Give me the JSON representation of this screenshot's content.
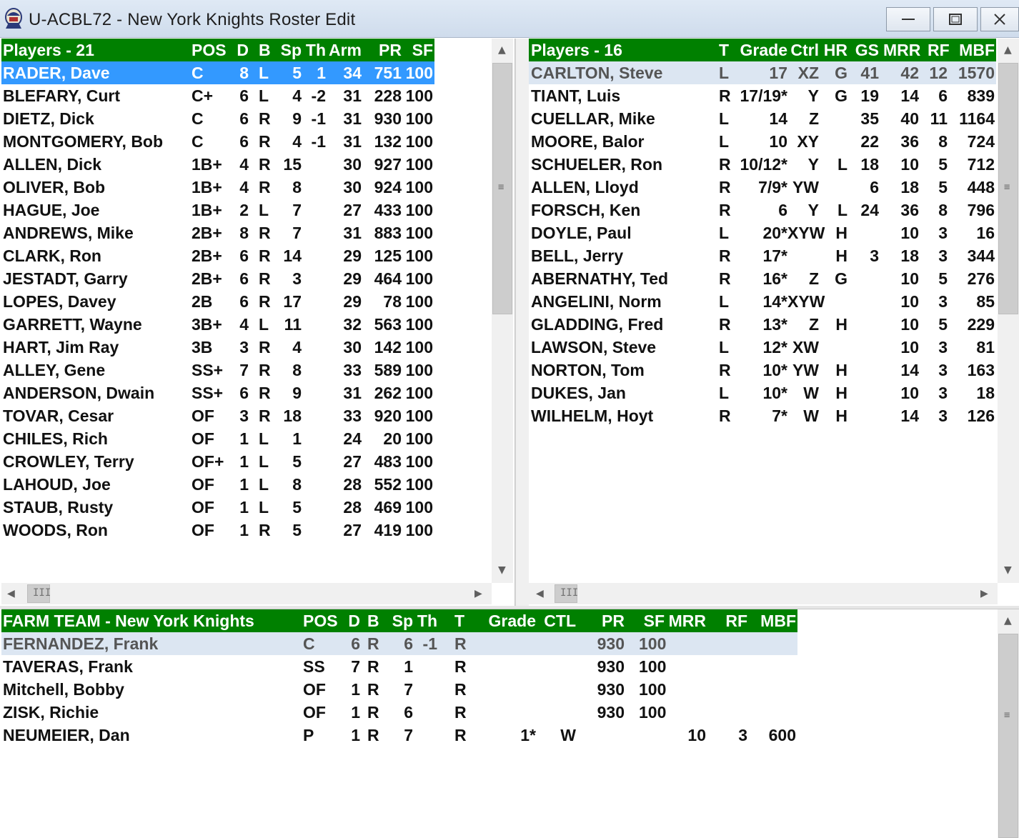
{
  "window": {
    "title": "U-ACBL72 - New York Knights Roster Edit"
  },
  "players": {
    "headers": [
      "Players - 21",
      "POS",
      "D",
      "B",
      "Sp",
      "Th",
      "Arm",
      "PR",
      "SF"
    ],
    "rows": [
      [
        "RADER, Dave",
        "C",
        "8",
        "L",
        "5",
        "1",
        "34",
        "751",
        "100"
      ],
      [
        "BLEFARY, Curt",
        "C+",
        "6",
        "L",
        "4",
        "-2",
        "31",
        "228",
        "100"
      ],
      [
        "DIETZ, Dick",
        "C",
        "6",
        "R",
        "9",
        "-1",
        "31",
        "930",
        "100"
      ],
      [
        "MONTGOMERY, Bob",
        "C",
        "6",
        "R",
        "4",
        "-1",
        "31",
        "132",
        "100"
      ],
      [
        "ALLEN, Dick",
        "1B+",
        "4",
        "R",
        "15",
        "",
        "30",
        "927",
        "100"
      ],
      [
        "OLIVER, Bob",
        "1B+",
        "4",
        "R",
        "8",
        "",
        "30",
        "924",
        "100"
      ],
      [
        "HAGUE, Joe",
        "1B+",
        "2",
        "L",
        "7",
        "",
        "27",
        "433",
        "100"
      ],
      [
        "ANDREWS, Mike",
        "2B+",
        "8",
        "R",
        "7",
        "",
        "31",
        "883",
        "100"
      ],
      [
        "CLARK, Ron",
        "2B+",
        "6",
        "R",
        "14",
        "",
        "29",
        "125",
        "100"
      ],
      [
        "JESTADT, Garry",
        "2B+",
        "6",
        "R",
        "3",
        "",
        "29",
        "464",
        "100"
      ],
      [
        "LOPES, Davey",
        "2B",
        "6",
        "R",
        "17",
        "",
        "29",
        "78",
        "100"
      ],
      [
        "GARRETT, Wayne",
        "3B+",
        "4",
        "L",
        "11",
        "",
        "32",
        "563",
        "100"
      ],
      [
        "HART, Jim Ray",
        "3B",
        "3",
        "R",
        "4",
        "",
        "30",
        "142",
        "100"
      ],
      [
        "ALLEY, Gene",
        "SS+",
        "7",
        "R",
        "8",
        "",
        "33",
        "589",
        "100"
      ],
      [
        "ANDERSON, Dwain",
        "SS+",
        "6",
        "R",
        "9",
        "",
        "31",
        "262",
        "100"
      ],
      [
        "TOVAR, Cesar",
        "OF",
        "3",
        "R",
        "18",
        "",
        "33",
        "920",
        "100"
      ],
      [
        "CHILES, Rich",
        "OF",
        "1",
        "L",
        "1",
        "",
        "24",
        "20",
        "100"
      ],
      [
        "CROWLEY, Terry",
        "OF+",
        "1",
        "L",
        "5",
        "",
        "27",
        "483",
        "100"
      ],
      [
        "LAHOUD, Joe",
        "OF",
        "1",
        "L",
        "8",
        "",
        "28",
        "552",
        "100"
      ],
      [
        "STAUB, Rusty",
        "OF",
        "1",
        "L",
        "5",
        "",
        "28",
        "469",
        "100"
      ],
      [
        "WOODS, Ron",
        "OF",
        "1",
        "R",
        "5",
        "",
        "27",
        "419",
        "100"
      ]
    ]
  },
  "pitchers": {
    "headers": [
      "Players - 16",
      "T",
      "Grade",
      "Ctrl",
      "HR",
      "GS",
      "MRR",
      "RF",
      "MBF"
    ],
    "rows": [
      [
        "CARLTON, Steve",
        "L",
        "17",
        "XZ",
        "G",
        "41",
        "42",
        "12",
        "1570"
      ],
      [
        "TIANT, Luis",
        "R",
        "17/19*",
        "Y",
        "G",
        "19",
        "14",
        "6",
        "839"
      ],
      [
        "CUELLAR, Mike",
        "L",
        "14",
        "Z",
        "",
        "35",
        "40",
        "11",
        "1164"
      ],
      [
        "MOORE, Balor",
        "L",
        "10",
        "XY",
        "",
        "22",
        "36",
        "8",
        "724"
      ],
      [
        "SCHUELER, Ron",
        "R",
        "10/12*",
        "Y",
        "L",
        "18",
        "10",
        "5",
        "712"
      ],
      [
        "ALLEN, Lloyd",
        "R",
        "7/9*",
        "YW",
        "",
        "6",
        "18",
        "5",
        "448"
      ],
      [
        "FORSCH, Ken",
        "R",
        "6",
        "Y",
        "L",
        "24",
        "36",
        "8",
        "796"
      ],
      [
        "DOYLE, Paul",
        "L",
        "20*",
        "XYW",
        "H",
        "",
        "10",
        "3",
        "16"
      ],
      [
        "BELL, Jerry",
        "R",
        "17*",
        "",
        "H",
        "3",
        "18",
        "3",
        "344"
      ],
      [
        "ABERNATHY, Ted",
        "R",
        "16*",
        "Z",
        "G",
        "",
        "10",
        "5",
        "276"
      ],
      [
        "ANGELINI, Norm",
        "L",
        "14*",
        "XYW",
        "",
        "",
        "10",
        "3",
        "85"
      ],
      [
        "GLADDING, Fred",
        "R",
        "13*",
        "Z",
        "H",
        "",
        "10",
        "5",
        "229"
      ],
      [
        "LAWSON, Steve",
        "L",
        "12*",
        "XW",
        "",
        "",
        "10",
        "3",
        "81"
      ],
      [
        "NORTON, Tom",
        "R",
        "10*",
        "YW",
        "H",
        "",
        "14",
        "3",
        "163"
      ],
      [
        "DUKES, Jan",
        "L",
        "10*",
        "W",
        "H",
        "",
        "10",
        "3",
        "18"
      ],
      [
        "WILHELM, Hoyt",
        "R",
        "7*",
        "W",
        "H",
        "",
        "14",
        "3",
        "126"
      ]
    ]
  },
  "farm": {
    "headers": [
      "FARM TEAM - New York Knights",
      "POS",
      "D",
      "B",
      "Sp",
      "Th",
      "T",
      "Grade",
      "CTL",
      "PR",
      "SF",
      "MRR",
      "RF",
      "MBF"
    ],
    "rows": [
      [
        "FERNANDEZ, Frank",
        "C",
        "6",
        "R",
        "6",
        "-1",
        "R",
        "",
        "",
        "930",
        "100",
        "",
        "",
        ""
      ],
      [
        "TAVERAS, Frank",
        "SS",
        "7",
        "R",
        "1",
        "",
        "R",
        "",
        "",
        "930",
        "100",
        "",
        "",
        ""
      ],
      [
        "Mitchell, Bobby",
        "OF",
        "1",
        "R",
        "7",
        "",
        "R",
        "",
        "",
        "930",
        "100",
        "",
        "",
        ""
      ],
      [
        "ZISK, Richie",
        "OF",
        "1",
        "R",
        "6",
        "",
        "R",
        "",
        "",
        "930",
        "100",
        "",
        "",
        ""
      ],
      [
        "NEUMEIER, Dan",
        "P",
        "1",
        "R",
        "7",
        "",
        "R",
        "1*",
        "W",
        "",
        "",
        "10",
        "3",
        "600"
      ]
    ]
  },
  "colors": {
    "header_green": "#008000",
    "selected_blue": "#3399ff",
    "current_row": "#dce6f2"
  },
  "icons": {
    "app": "team-logo-icon",
    "minimize": "minimize-icon",
    "maximize": "maximize-icon",
    "close": "close-icon"
  }
}
